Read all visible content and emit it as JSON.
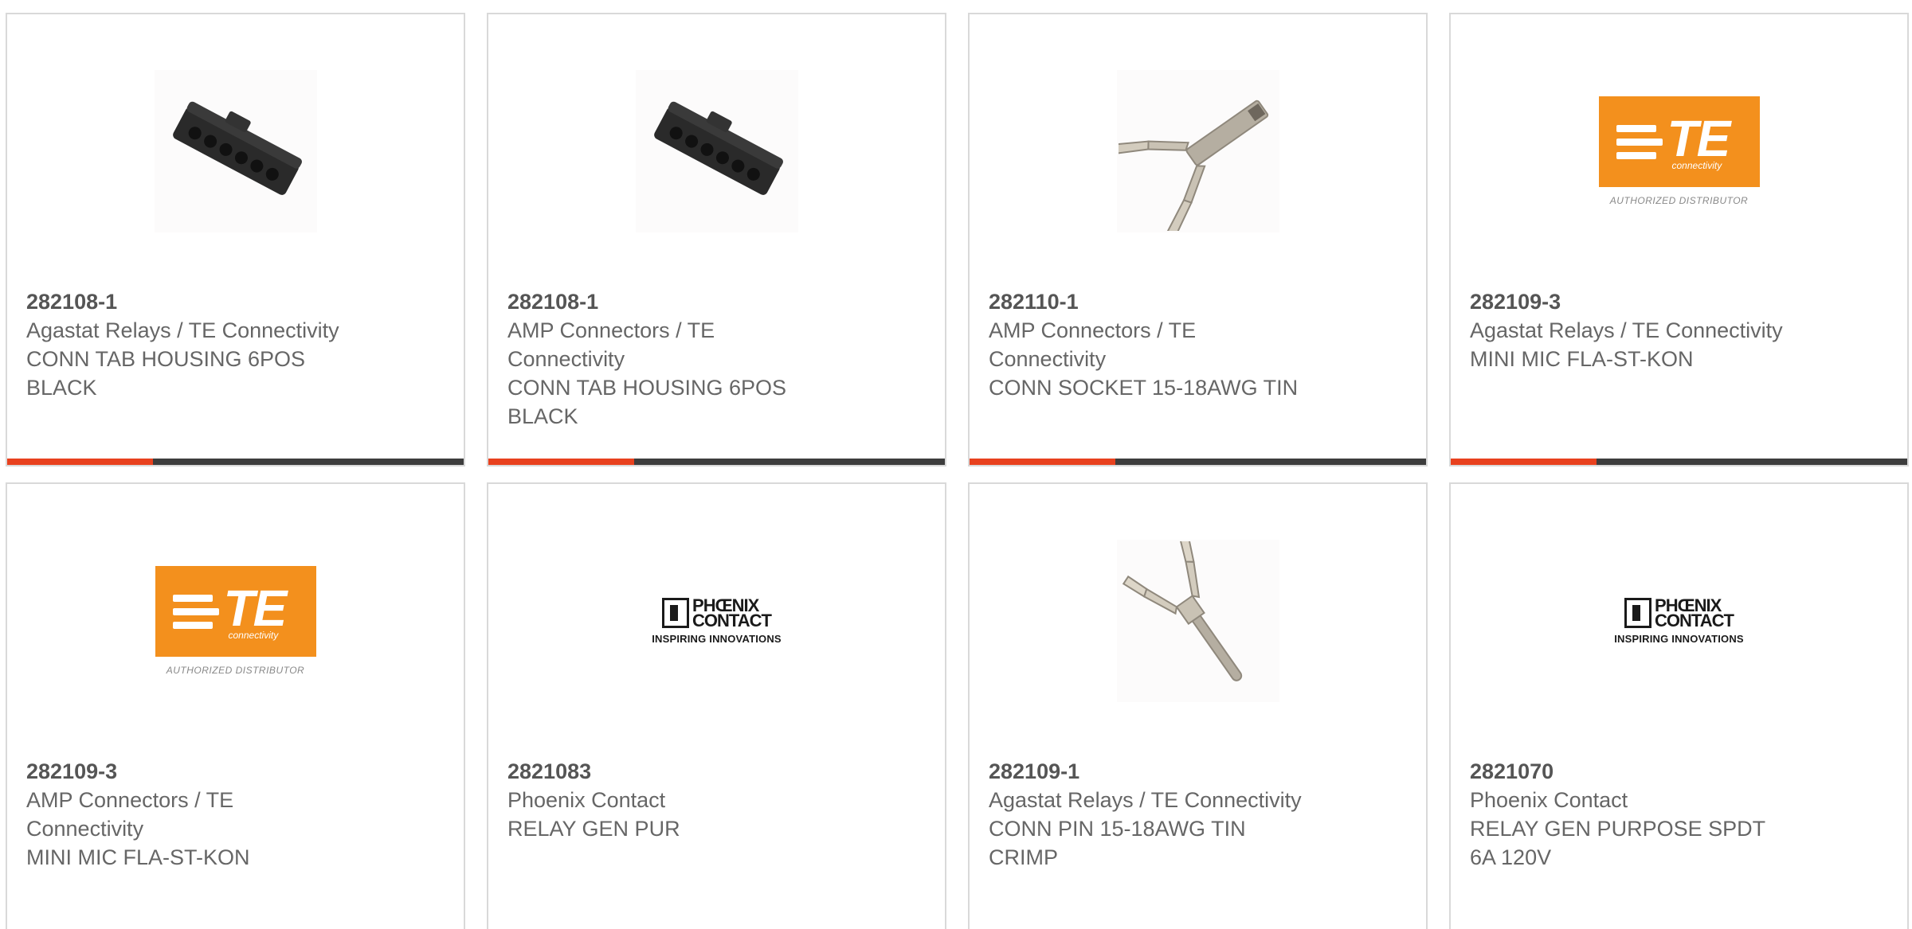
{
  "cards": [
    {
      "part": "282108-1",
      "lines": [
        "Agastat Relays / TE Connectivity",
        "CONN TAB HOUSING 6POS",
        "BLACK"
      ],
      "image": "connector-housing-black"
    },
    {
      "part": "282108-1",
      "lines": [
        "AMP Connectors / TE",
        "Connectivity",
        "CONN TAB HOUSING 6POS",
        "BLACK"
      ],
      "image": "connector-housing-black"
    },
    {
      "part": "282110-1",
      "lines": [
        "AMP Connectors / TE",
        "Connectivity",
        "CONN SOCKET 15-18AWG TIN"
      ],
      "image": "crimp-socket-contact"
    },
    {
      "part": "282109-3",
      "lines": [
        "Agastat Relays / TE Connectivity",
        "MINI MIC FLA-ST-KON"
      ],
      "image": "te-connectivity-logo"
    },
    {
      "part": "282109-3",
      "lines": [
        "AMP Connectors / TE",
        "Connectivity",
        "MINI MIC FLA-ST-KON"
      ],
      "image": "te-connectivity-logo"
    },
    {
      "part": "2821083",
      "lines": [
        "Phoenix Contact",
        "RELAY GEN PUR"
      ],
      "image": "phoenix-contact-logo"
    },
    {
      "part": "282109-1",
      "lines": [
        "Agastat Relays / TE Connectivity",
        "CONN PIN 15-18AWG TIN",
        "CRIMP"
      ],
      "image": "crimp-pin-contact"
    },
    {
      "part": "2821070",
      "lines": [
        "Phoenix Contact",
        "RELAY GEN PURPOSE SPDT",
        "6A 120V"
      ],
      "image": "phoenix-contact-logo"
    }
  ],
  "logos": {
    "te": {
      "mark": "TE",
      "sub": "connectivity",
      "tagline": "AUTHORIZED DISTRIBUTOR"
    },
    "phoenix": {
      "line1": "PHŒNIX",
      "line2": "CONTACT",
      "tagline": "INSPIRING INNOVATIONS"
    }
  },
  "colors": {
    "accent": "#e8411e",
    "bar": "#3d3d3d",
    "te_orange": "#f3901d",
    "text": "#666666"
  }
}
